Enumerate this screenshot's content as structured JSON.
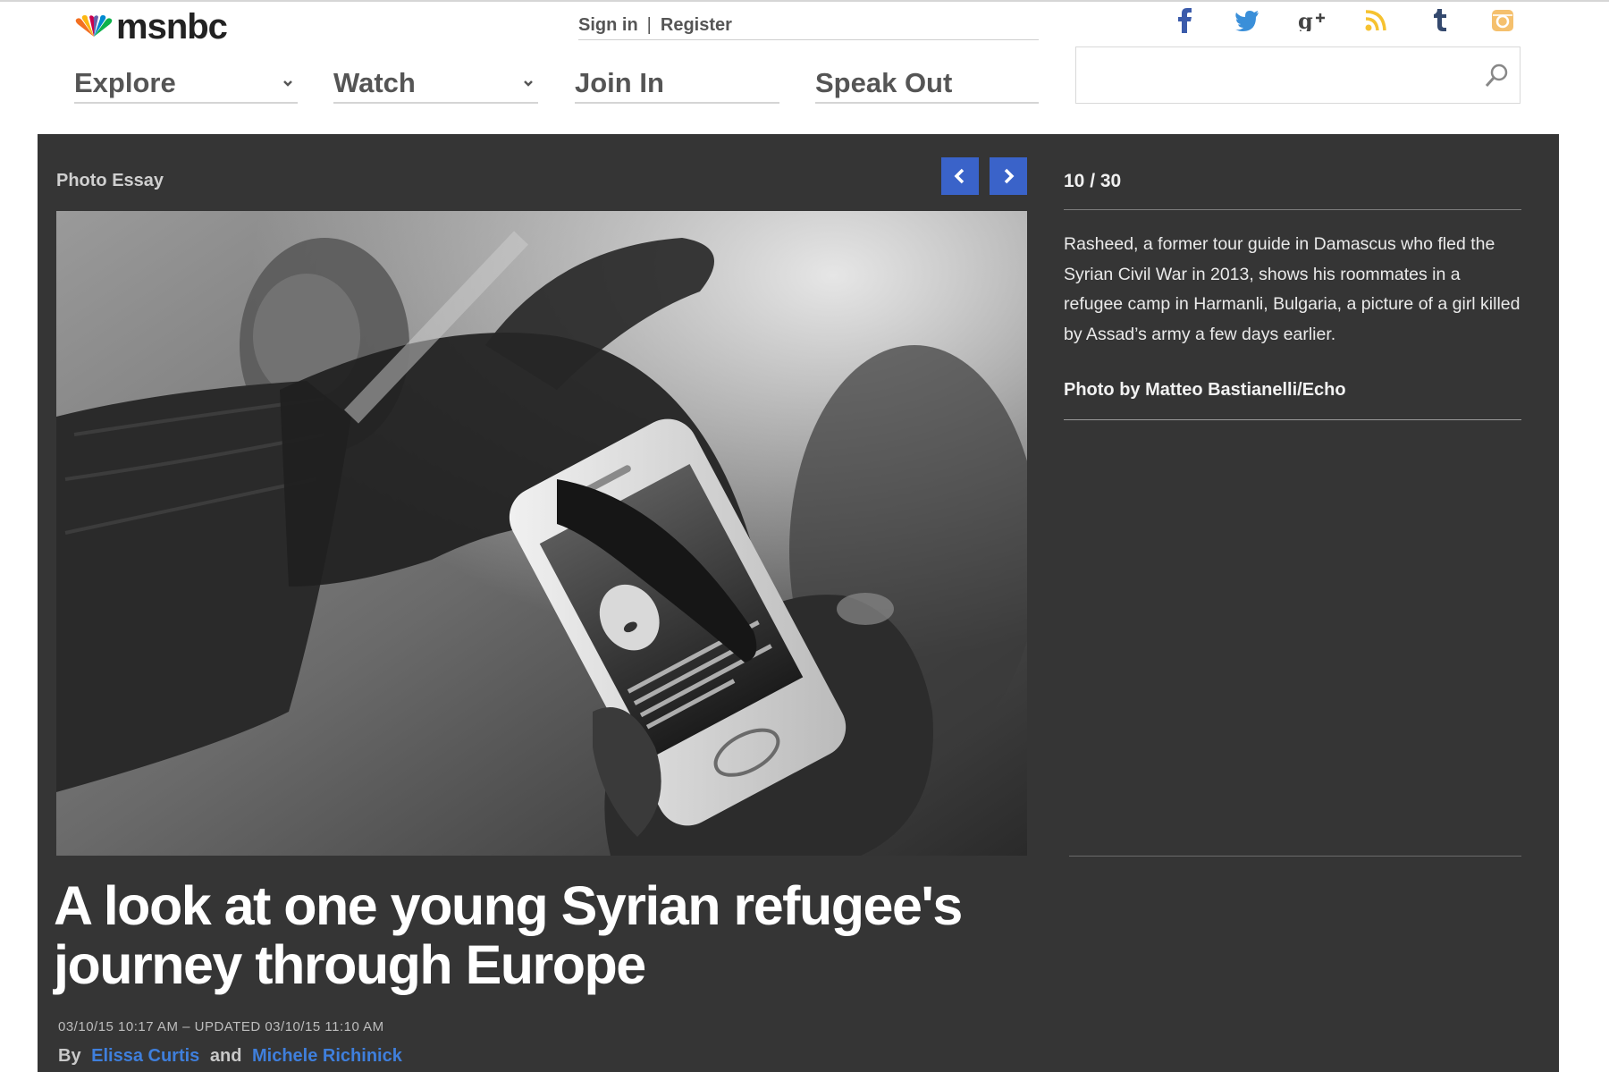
{
  "brand": {
    "logo_text": "msnbc"
  },
  "auth": {
    "sign_in": "Sign in",
    "separator": "|",
    "register": "Register"
  },
  "social": [
    "facebook-icon",
    "twitter-icon",
    "google-plus-icon",
    "rss-icon",
    "tumblr-icon",
    "instagram-icon"
  ],
  "colors": {
    "accent": "#3a63c9",
    "panel": "#353535",
    "link": "#3f7fdc"
  },
  "nav": [
    {
      "label": "Explore",
      "has_dropdown": true
    },
    {
      "label": "Watch",
      "has_dropdown": true
    },
    {
      "label": "Join In",
      "has_dropdown": false
    },
    {
      "label": "Speak Out",
      "has_dropdown": false
    }
  ],
  "search": {
    "value": "",
    "placeholder": ""
  },
  "slideshow": {
    "kicker": "Photo Essay",
    "counter": "10 / 30",
    "caption": "Rasheed, a former tour guide in Damascus who fled the Syrian Civil War in 2013, shows his roommates in a refugee camp in Harmanli, Bulgaria, a picture of a girl killed by Assad’s army a few days earlier.",
    "credit": "Photo by Matteo Bastianelli/Echo"
  },
  "article": {
    "headline": "A look at one young Syrian refugee's journey through Europe",
    "dateline": "03/10/15 10:17 AM – UPDATED 03/10/15 11:10 AM",
    "by_label": "By",
    "author1": "Elissa Curtis",
    "and_label": "and",
    "author2": "Michele Richinick"
  }
}
